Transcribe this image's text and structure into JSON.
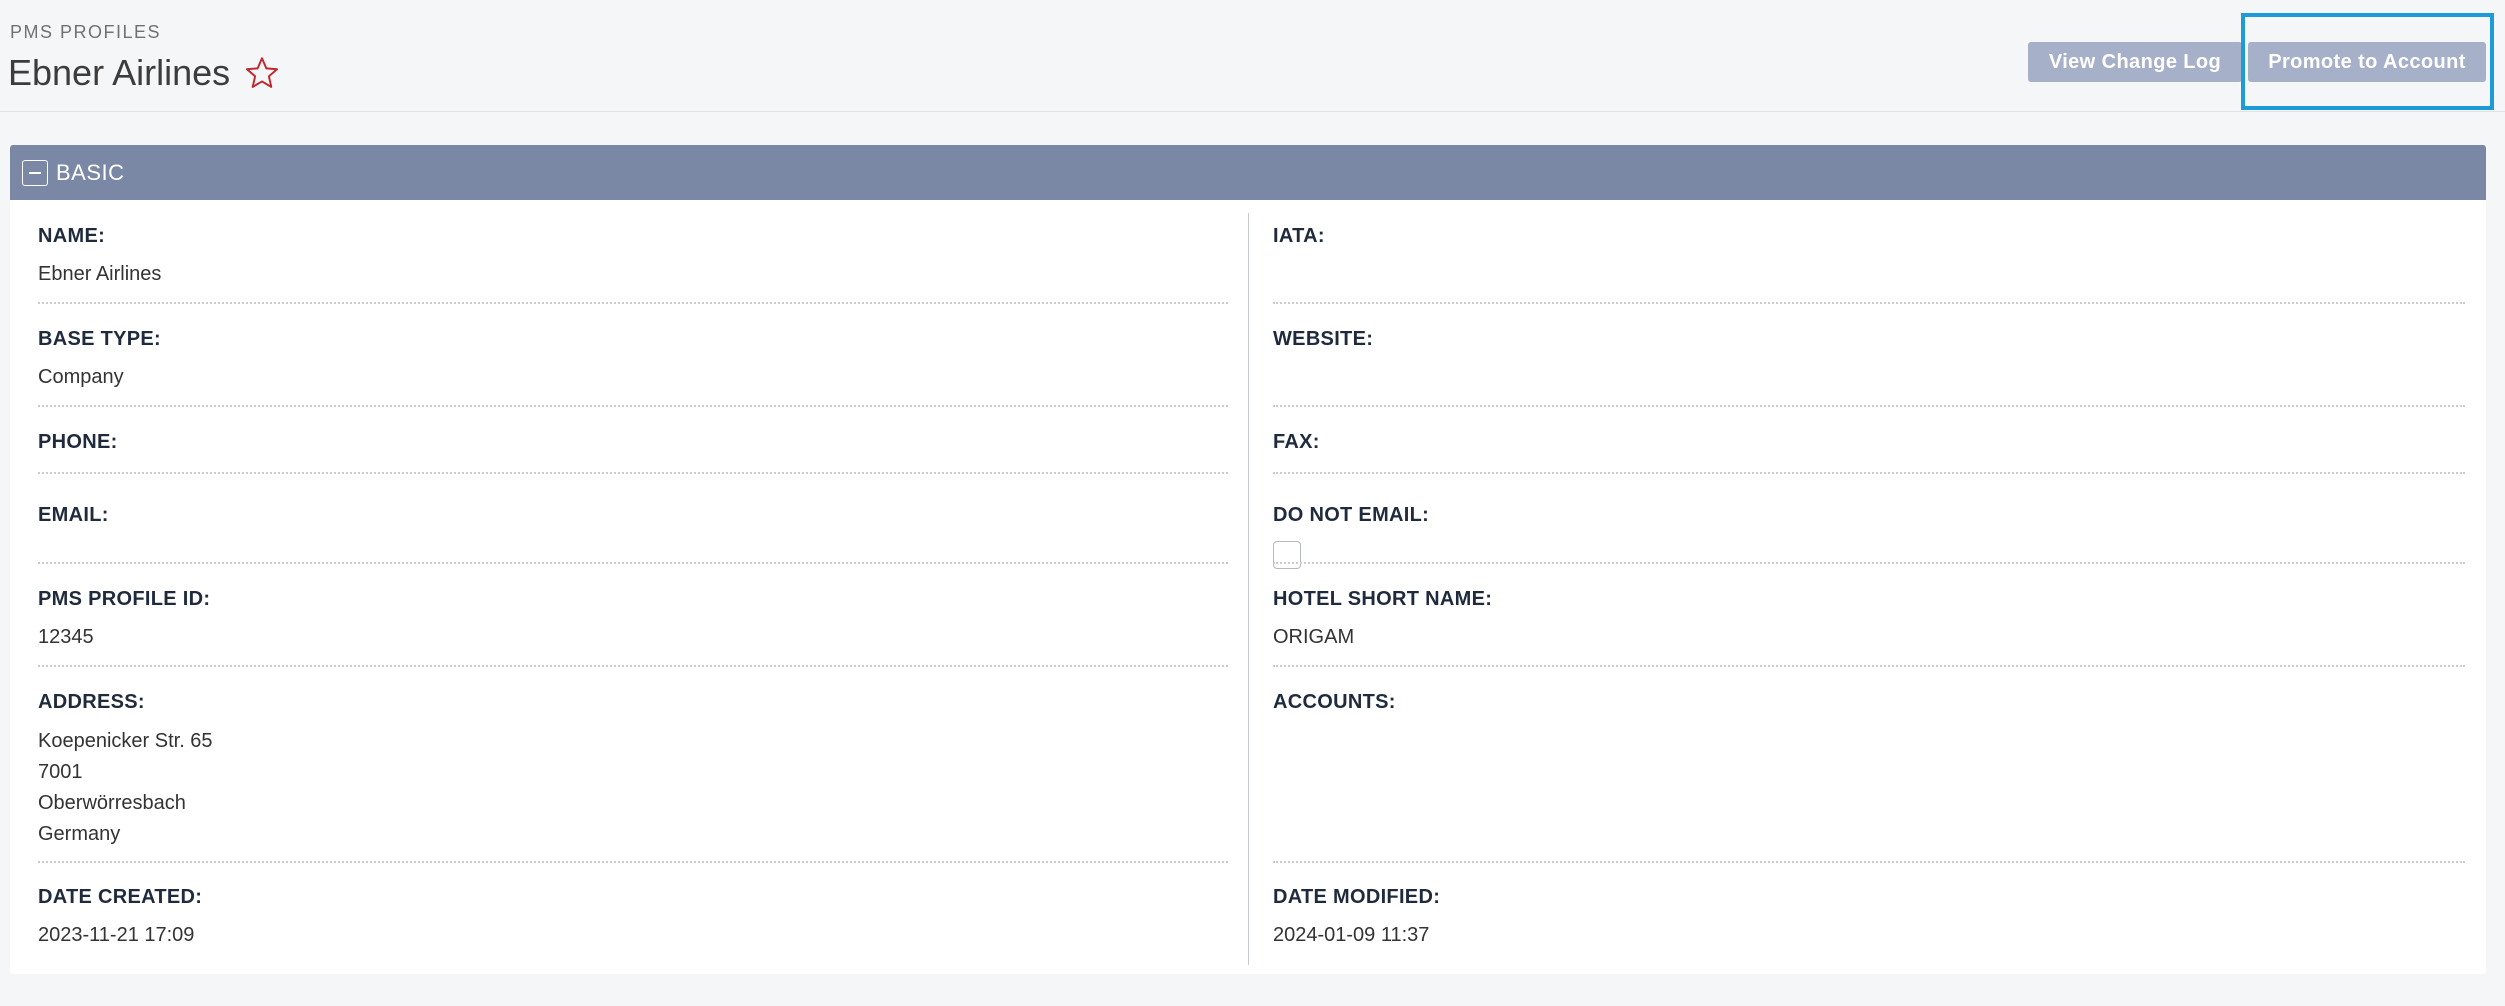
{
  "header": {
    "module_label": "PMS PROFILES",
    "record_title": "Ebner Airlines",
    "favorite_icon": "star-outline-icon",
    "favorite_color": "#c0272d",
    "buttons": {
      "view_change_log": "View Change Log",
      "promote_to_account": "Promote to Account"
    },
    "highlight_color": "#1d9ad8"
  },
  "panel": {
    "title": "BASIC",
    "header_color": "#7a88a6",
    "collapse_icon": "minus-icon"
  },
  "fields": {
    "name": {
      "label": "NAME:",
      "value": "Ebner Airlines"
    },
    "iata": {
      "label": "IATA:",
      "value": ""
    },
    "base_type": {
      "label": "BASE TYPE:",
      "value": "Company"
    },
    "website": {
      "label": "WEBSITE:",
      "value": ""
    },
    "phone": {
      "label": "PHONE:",
      "value": ""
    },
    "fax": {
      "label": "FAX:",
      "value": ""
    },
    "email": {
      "label": "EMAIL:",
      "value": ""
    },
    "do_not_email": {
      "label": "DO NOT EMAIL:",
      "checked": false
    },
    "pms_profile_id": {
      "label": "PMS PROFILE ID:",
      "value": "12345"
    },
    "hotel_short_name": {
      "label": "HOTEL SHORT NAME:",
      "value": "ORIGAM"
    },
    "address": {
      "label": "ADDRESS:",
      "lines": [
        "Koepenicker Str. 65",
        "7001",
        "Oberwörresbach",
        "Germany"
      ]
    },
    "accounts": {
      "label": "ACCOUNTS:",
      "value": ""
    },
    "date_created": {
      "label": "DATE CREATED:",
      "value": "2023-11-21 17:09"
    },
    "date_modified": {
      "label": "DATE MODIFIED:",
      "value": "2024-01-09 11:37"
    }
  }
}
